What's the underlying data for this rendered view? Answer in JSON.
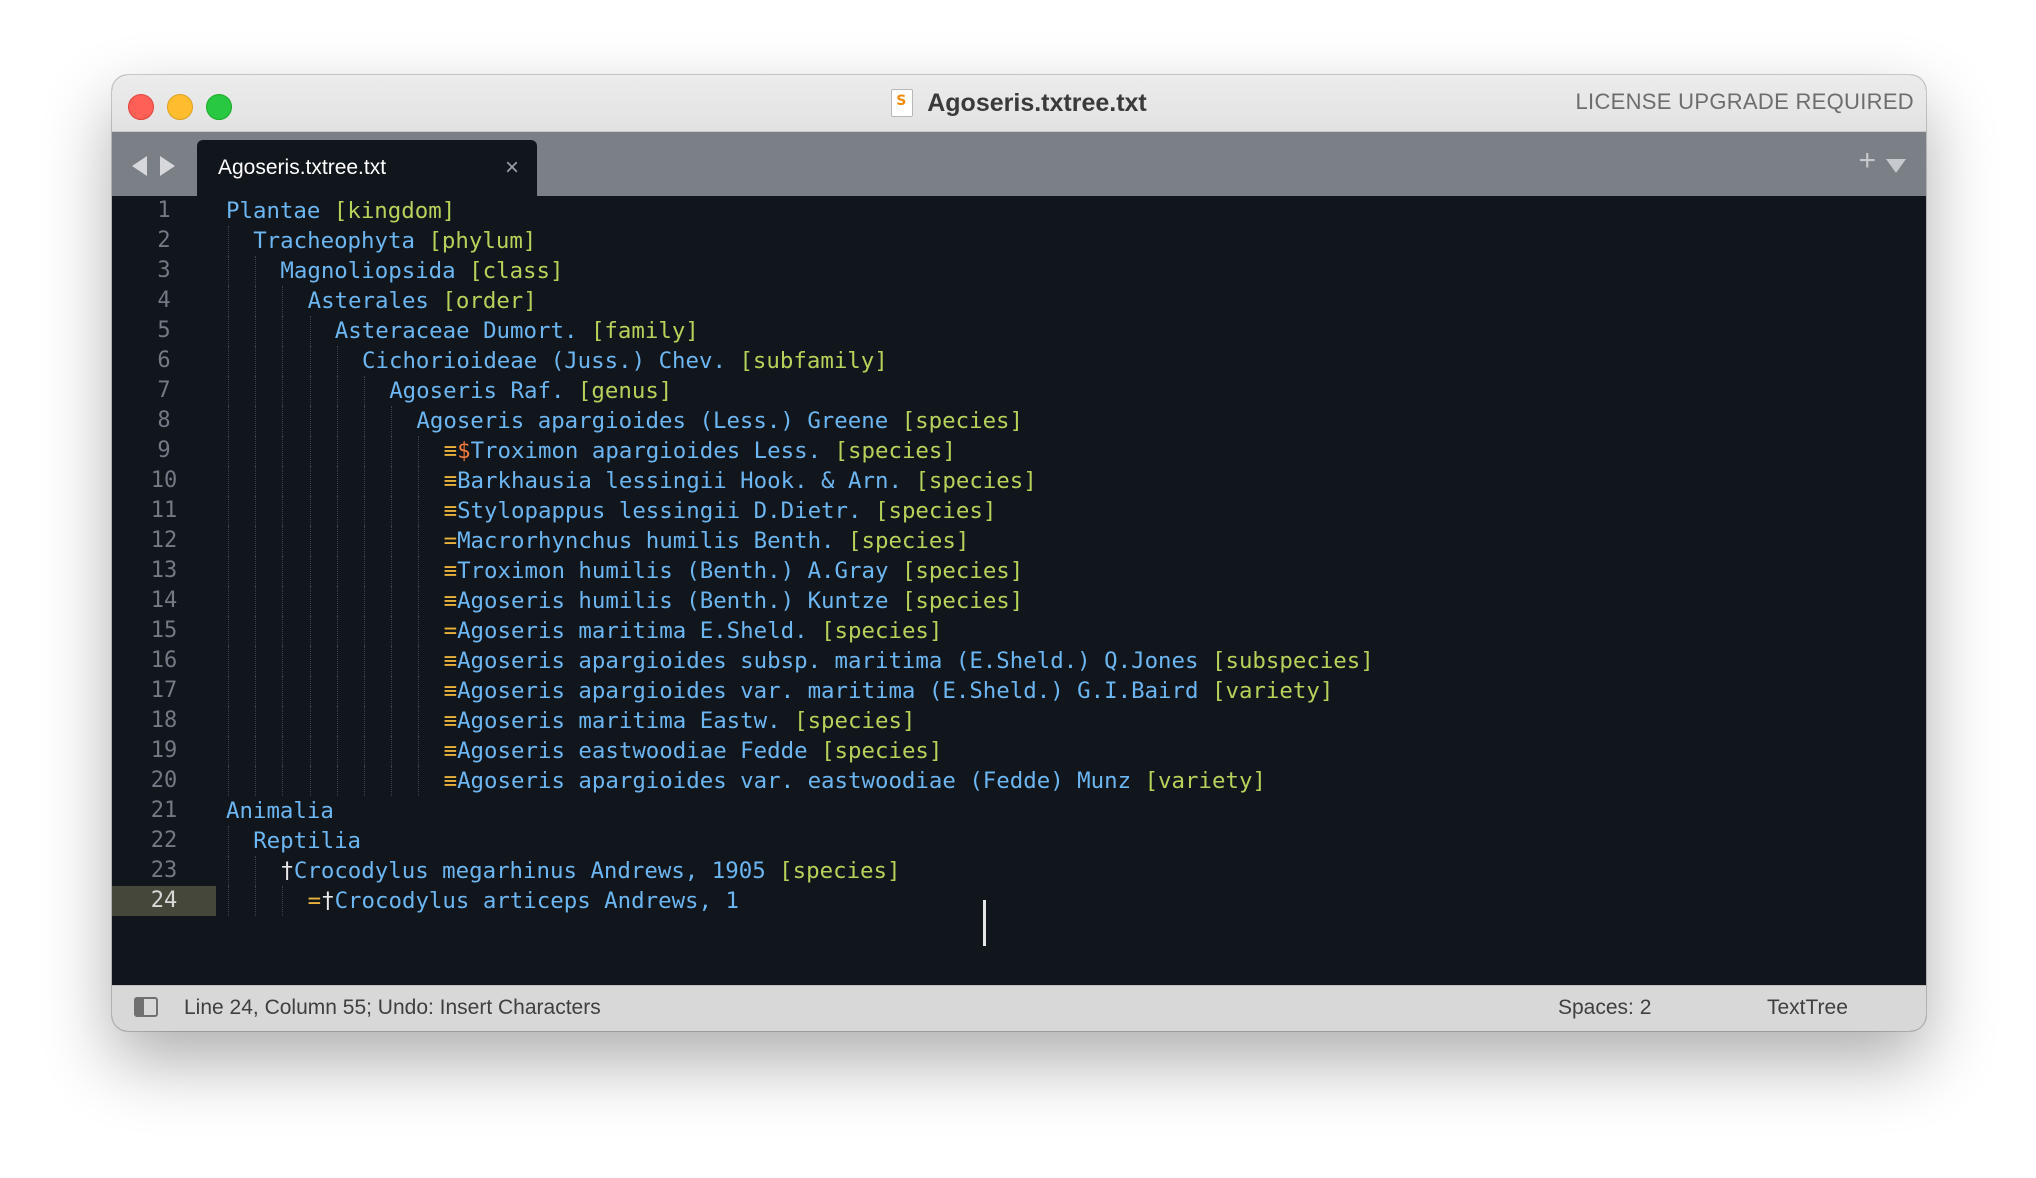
{
  "window": {
    "title": "Agoseris.txtree.txt",
    "license_notice": "LICENSE UPGRADE REQUIRED",
    "file_icon": "sublime-document-icon"
  },
  "tabs": {
    "active_label": "Agoseris.txtree.txt",
    "close_glyph": "×",
    "new_tab_glyph": "+"
  },
  "editor": {
    "current_line": 24,
    "lines": [
      {
        "num": "1",
        "indent": 0,
        "syn": "",
        "mark": "",
        "name": "Plantae",
        "rank": "[kingdom]"
      },
      {
        "num": "2",
        "indent": 1,
        "syn": "",
        "mark": "",
        "name": "Tracheophyta",
        "rank": "[phylum]"
      },
      {
        "num": "3",
        "indent": 2,
        "syn": "",
        "mark": "",
        "name": "Magnoliopsida",
        "rank": "[class]"
      },
      {
        "num": "4",
        "indent": 3,
        "syn": "",
        "mark": "",
        "name": "Asterales",
        "rank": "[order]"
      },
      {
        "num": "5",
        "indent": 4,
        "syn": "",
        "mark": "",
        "name": "Asteraceae Dumort.",
        "rank": "[family]"
      },
      {
        "num": "6",
        "indent": 5,
        "syn": "",
        "mark": "",
        "name": "Cichorioideae (Juss.) Chev.",
        "rank": "[subfamily]"
      },
      {
        "num": "7",
        "indent": 6,
        "syn": "",
        "mark": "",
        "name": "Agoseris Raf.",
        "rank": "[genus]"
      },
      {
        "num": "8",
        "indent": 7,
        "syn": "",
        "mark": "",
        "name": "Agoseris apargioides (Less.) Greene",
        "rank": "[species]"
      },
      {
        "num": "9",
        "indent": 8,
        "syn": "≡",
        "mark": "$",
        "name": "Troximon apargioides Less.",
        "rank": "[species]"
      },
      {
        "num": "10",
        "indent": 8,
        "syn": "≡",
        "mark": "",
        "name": "Barkhausia lessingii Hook. & Arn.",
        "rank": "[species]"
      },
      {
        "num": "11",
        "indent": 8,
        "syn": "≡",
        "mark": "",
        "name": "Stylopappus lessingii D.Dietr.",
        "rank": "[species]"
      },
      {
        "num": "12",
        "indent": 8,
        "syn": "=",
        "mark": "",
        "name": "Macrorhynchus humilis Benth.",
        "rank": "[species]"
      },
      {
        "num": "13",
        "indent": 8,
        "syn": "≡",
        "mark": "",
        "name": "Troximon humilis (Benth.) A.Gray",
        "rank": "[species]"
      },
      {
        "num": "14",
        "indent": 8,
        "syn": "≡",
        "mark": "",
        "name": "Agoseris humilis (Benth.) Kuntze",
        "rank": "[species]"
      },
      {
        "num": "15",
        "indent": 8,
        "syn": "=",
        "mark": "",
        "name": "Agoseris maritima E.Sheld.",
        "rank": "[species]"
      },
      {
        "num": "16",
        "indent": 8,
        "syn": "≡",
        "mark": "",
        "name": "Agoseris apargioides subsp. maritima (E.Sheld.) Q.Jones",
        "rank": "[subspecies]"
      },
      {
        "num": "17",
        "indent": 8,
        "syn": "≡",
        "mark": "",
        "name": "Agoseris apargioides var. maritima (E.Sheld.) G.I.Baird",
        "rank": "[variety]"
      },
      {
        "num": "18",
        "indent": 8,
        "syn": "≡",
        "mark": "",
        "name": "Agoseris maritima Eastw.",
        "rank": "[species]"
      },
      {
        "num": "19",
        "indent": 8,
        "syn": "≡",
        "mark": "",
        "name": "Agoseris eastwoodiae Fedde",
        "rank": "[species]"
      },
      {
        "num": "20",
        "indent": 8,
        "syn": "≡",
        "mark": "",
        "name": "Agoseris apargioides var. eastwoodiae (Fedde) Munz",
        "rank": "[variety]"
      },
      {
        "num": "21",
        "indent": 0,
        "syn": "",
        "mark": "",
        "name": "Animalia",
        "rank": ""
      },
      {
        "num": "22",
        "indent": 1,
        "syn": "",
        "mark": "",
        "name": "Reptilia",
        "rank": ""
      },
      {
        "num": "23",
        "indent": 2,
        "syn": "",
        "mark": "†",
        "name": "Crocodylus megarhinus Andrews, 1905",
        "rank": "[species]"
      },
      {
        "num": "24",
        "indent": 3,
        "syn": "=",
        "mark": "†",
        "name": "Crocodylus articeps Andrews, 1",
        "rank": ""
      }
    ]
  },
  "status": {
    "position": "Line 24, Column 55; Undo: Insert Characters",
    "indentation": "Spaces: 2",
    "syntax": "TextTree"
  },
  "colors": {
    "name": "#6cb6f2",
    "rank": "#b5d25a",
    "synonym": "#e8b33c",
    "dollar": "#f17b3b",
    "background": "#11151c"
  }
}
